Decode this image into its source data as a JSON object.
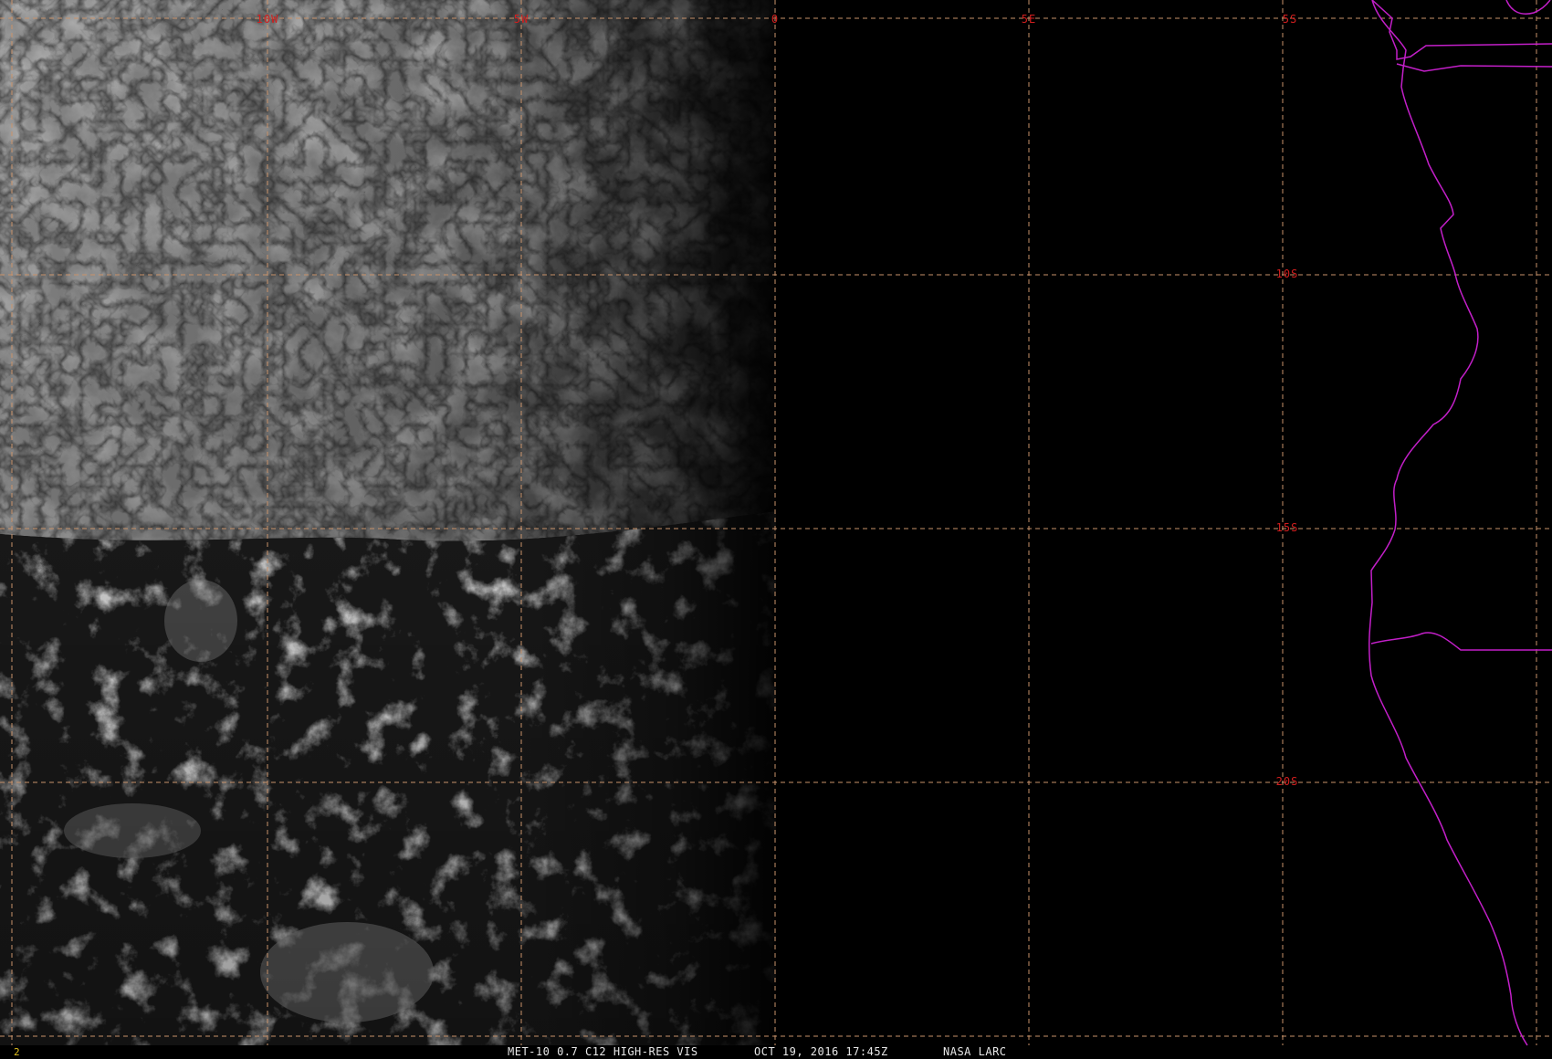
{
  "image": {
    "description_caption": "MET-10 0.7 C12 HIGH-RES VIS",
    "datetime": "OCT 19, 2016 17:45Z",
    "credit": "NASA LARC",
    "frame_number": "2"
  },
  "grid": {
    "longitude_labels": [
      "10W",
      "5W",
      "0",
      "5E"
    ],
    "latitude_labels": [
      "5S",
      "10S",
      "15S",
      "20S"
    ],
    "label_color": "#d21e1e",
    "line_color": "#c8926a"
  },
  "overlay": {
    "coastline_color": "#c21fc8"
  }
}
